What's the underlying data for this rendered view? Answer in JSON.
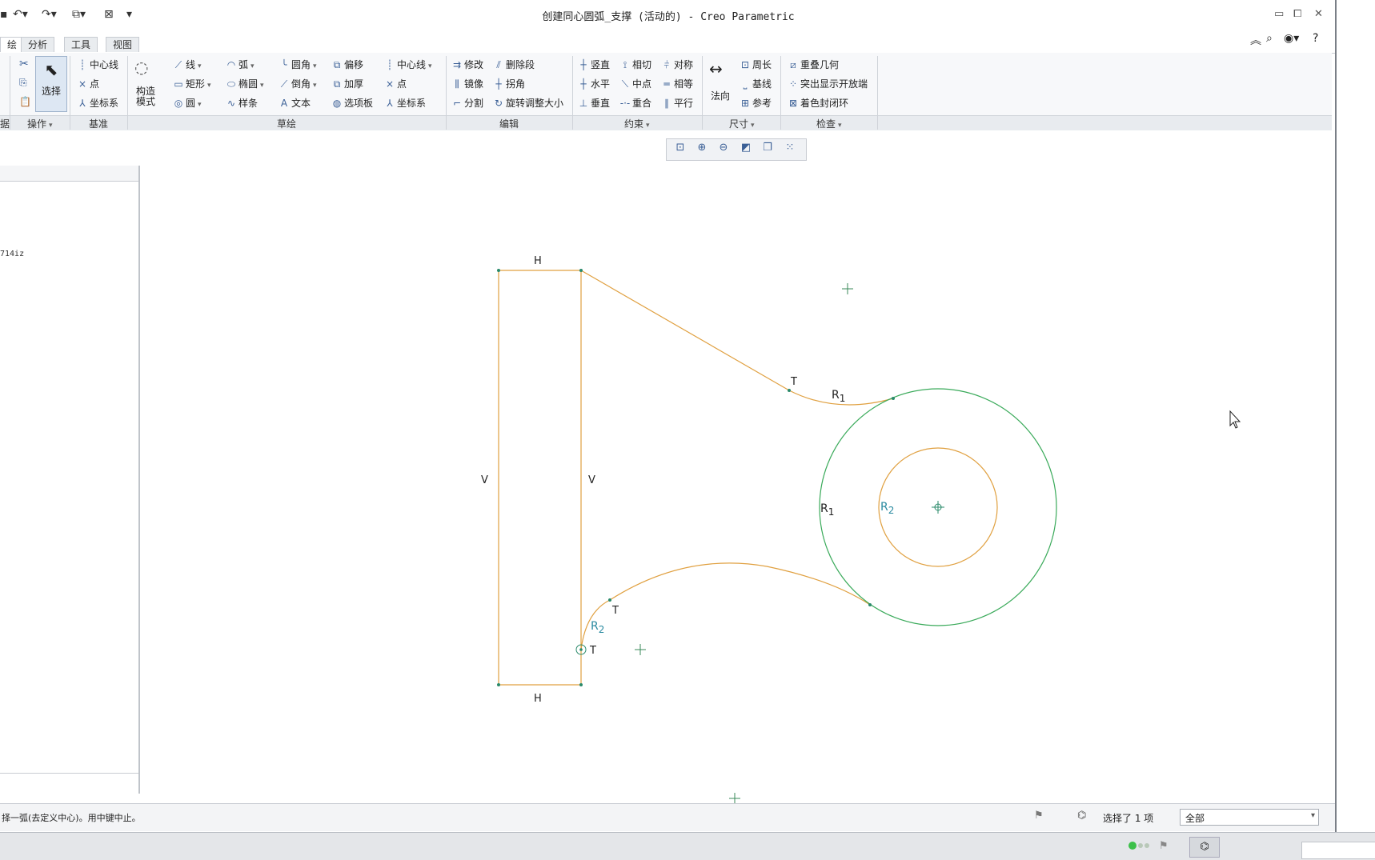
{
  "window": {
    "title": "创建同心圆弧_支撑 (活动的) - Creo Parametric"
  },
  "tabs": [
    "绘",
    "分析",
    "工具",
    "视图"
  ],
  "ribbon": {
    "ops": {
      "select": "选择"
    },
    "datum": {
      "centerline": "中心线",
      "point": "点",
      "csys": "坐标系"
    },
    "construct": "构造\n模式",
    "sketch": {
      "line": "线",
      "rect": "矩形",
      "circle": "圆",
      "arc": "弧",
      "ellipse": "椭圆",
      "spline": "样条",
      "fillet": "圆角",
      "chamfer": "倒角",
      "text": "文本",
      "offset": "偏移",
      "thicken": "加厚",
      "palette": "选项板",
      "centerline": "中心线",
      "point": "点",
      "csys": "坐标系"
    },
    "edit": {
      "modify": "修改",
      "mirror": "镜像",
      "divide": "分割",
      "delete_seg": "删除段",
      "corner": "拐角",
      "rotate_resize": "旋转调整大小"
    },
    "constrain": {
      "vertical": "竖直",
      "horizontal": "水平",
      "perpendicular": "垂直",
      "tangent": "相切",
      "midpoint": "中点",
      "coincident": "重合",
      "symmetric": "对称",
      "equal": "相等",
      "parallel": "平行"
    },
    "dimension": {
      "normal": "法向",
      "perimeter": "周长",
      "baseline": "基线",
      "reference": "参考"
    },
    "inspect": {
      "overlap": "重叠几何",
      "highlight_open": "突出显示开放端",
      "shade_closed": "着色封闭环"
    },
    "groups": {
      "data": "据",
      "operations": "操作",
      "datum": "基准",
      "sketch": "草绘",
      "edit": "编辑",
      "constrain": "约束",
      "dimension": "尺寸",
      "inspect": "检查"
    }
  },
  "left_panel": {
    "item": "714iz"
  },
  "sketch_labels": {
    "h_top": "H",
    "h_bottom": "H",
    "v_left": "V",
    "v_right": "V",
    "t1": "T",
    "t2": "T",
    "t3": "T",
    "r1_arc": "R",
    "r1_arc_sub": "1",
    "r1_circle": "R",
    "r1_circle_sub": "1",
    "r2_circle": "R",
    "r2_circle_sub": "2",
    "r2_arc": "R",
    "r2_arc_sub": "2"
  },
  "colors": {
    "geometry": "#e0a040",
    "green_circle": "#3aaa5a",
    "label": "#2a8aa0",
    "point": "#2a8a6a"
  },
  "status": {
    "message": "择一弧(去定义中心)。用中键中止。",
    "selected": "选择了 1 项",
    "filter": "全部"
  }
}
